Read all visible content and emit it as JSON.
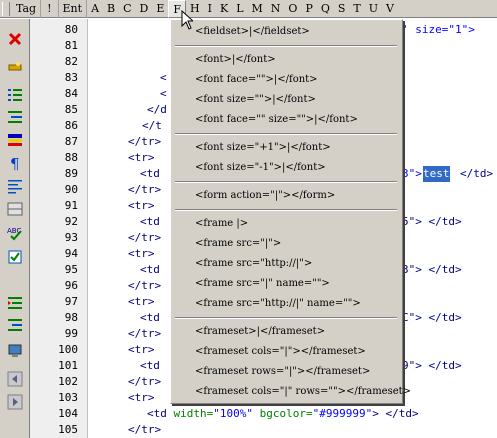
{
  "tagbar": {
    "items": [
      "Tag",
      "!",
      "Ent",
      "A",
      "B",
      "C",
      "D",
      "E",
      "F",
      "H",
      "I",
      "K",
      "L",
      "M",
      "N",
      "O",
      "P",
      "Q",
      "S",
      "T",
      "U",
      "V"
    ]
  },
  "editor": {
    "line_numbers": [
      "80",
      "81",
      "82",
      "83",
      "84",
      "85",
      "86",
      "87",
      "88",
      "89",
      "90",
      "91",
      "92",
      "93",
      "94",
      "95",
      "96",
      "97",
      "98",
      "99",
      "100",
      "101",
      "102",
      "103",
      "104",
      "105"
    ],
    "visible_fragments": {
      "l80": "' size=\"1\">",
      "l84a": "<",
      "l84b": "<",
      "l85": "</d",
      "l86": "</t",
      "l87": "</tr>",
      "l88": "<tr>",
      "l89a": "<td",
      "l89b": "3\">",
      "l89sel": "test",
      "l89c": "</td>",
      "l90": "</tr>",
      "l91": "<tr>",
      "l92a": "<td",
      "l92b": "5\"> </td>",
      "l93": "</tr>",
      "l94": "<tr>",
      "l95a": "<td",
      "l95b": "3\"> </td>",
      "l96": "</tr>",
      "l97": "<tr>",
      "l98a": "<td",
      "l98b": "C\"> </td>",
      "l99": "</tr>",
      "l100": "<tr>",
      "l101a": "<td",
      "l101b": "9\"> </td>",
      "l102": "</tr>",
      "l103": "<tr>",
      "l104_tag": "<td",
      "l104_attr1": "width=",
      "l104_val1": "\"100%\"",
      "l104_attr2": "bgcolor=",
      "l104_val2": "\"#999999\"",
      "l104_end": "> </td>",
      "l105": "</tr>"
    }
  },
  "menu": {
    "groups": [
      [
        "<fieldset>|</fieldset>"
      ],
      [
        "<font>|</font>",
        "<font face=\"\">|</font>",
        "<font size=\"\">|</font>",
        "<font face=\"\" size=\"\">|</font>"
      ],
      [
        "<font size=\"+1\">|</font>",
        "<font size=\"-1\">|</font>"
      ],
      [
        "<form action=\"|\"></form>"
      ],
      [
        "<frame |>",
        "<frame src=\"|\">",
        "<frame src=\"http://|\">",
        "<frame src=\"|\" name=\"\">",
        "<frame src=\"http://|\" name=\"\">"
      ],
      [
        "<frameset>|</frameset>",
        "<frameset cols=\"|\"></frameset>",
        "<frameset rows=\"|\"></frameset>",
        "<frameset cols=\"|\" rows=\"\"></frameset>"
      ]
    ]
  },
  "toolbar": {
    "icons": [
      "close-icon",
      "wand-icon",
      "ordered-list-icon",
      "indent-list-icon",
      "color-bars-icon",
      "paragraph-icon",
      "align-text-icon",
      "table-icon",
      "spellcheck-icon",
      "checklist-icon",
      "outdent-icon",
      "indent-icon",
      "monitor-icon",
      "first-page-icon",
      "last-page-icon"
    ]
  },
  "colors": {
    "tag": "#000080",
    "attr": "#008000",
    "value": "#0000ff",
    "selection": "#316ac5",
    "chrome": "#d4d0c8"
  }
}
